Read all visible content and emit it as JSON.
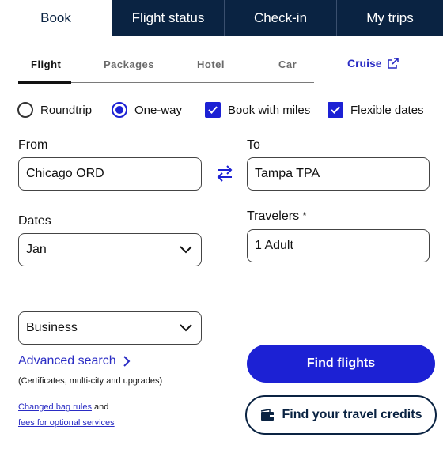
{
  "top_tabs": [
    "Book",
    "Flight status",
    "Check-in",
    "My trips"
  ],
  "sub_tabs": [
    "Flight",
    "Packages",
    "Hotel",
    "Car"
  ],
  "cruise_label": "Cruise",
  "options": {
    "roundtrip": "Roundtrip",
    "oneway": "One-way",
    "miles": "Book with miles",
    "flexible": "Flexible dates",
    "selected_trip": "One-way",
    "miles_checked": true,
    "flexible_checked": true
  },
  "from": {
    "label": "From",
    "value": "Chicago ORD"
  },
  "to": {
    "label": "To",
    "value": "Tampa TPA"
  },
  "dates": {
    "label": "Dates",
    "value": "Jan"
  },
  "travelers": {
    "label": "Travelers",
    "required_mark": "*",
    "value": "1 Adult"
  },
  "cabin": {
    "value": "Business"
  },
  "advanced": {
    "label": "Advanced search",
    "note": "(Certificates, multi-city and upgrades)"
  },
  "bag": {
    "link1": "Changed bag rules",
    "and": "and",
    "link2": "fees for optional services"
  },
  "buttons": {
    "find_flights": "Find flights",
    "travel_credits": "Find your travel credits"
  },
  "colors": {
    "navy": "#0a2342",
    "accent": "#1c21d4",
    "link": "#2a2cc4"
  }
}
